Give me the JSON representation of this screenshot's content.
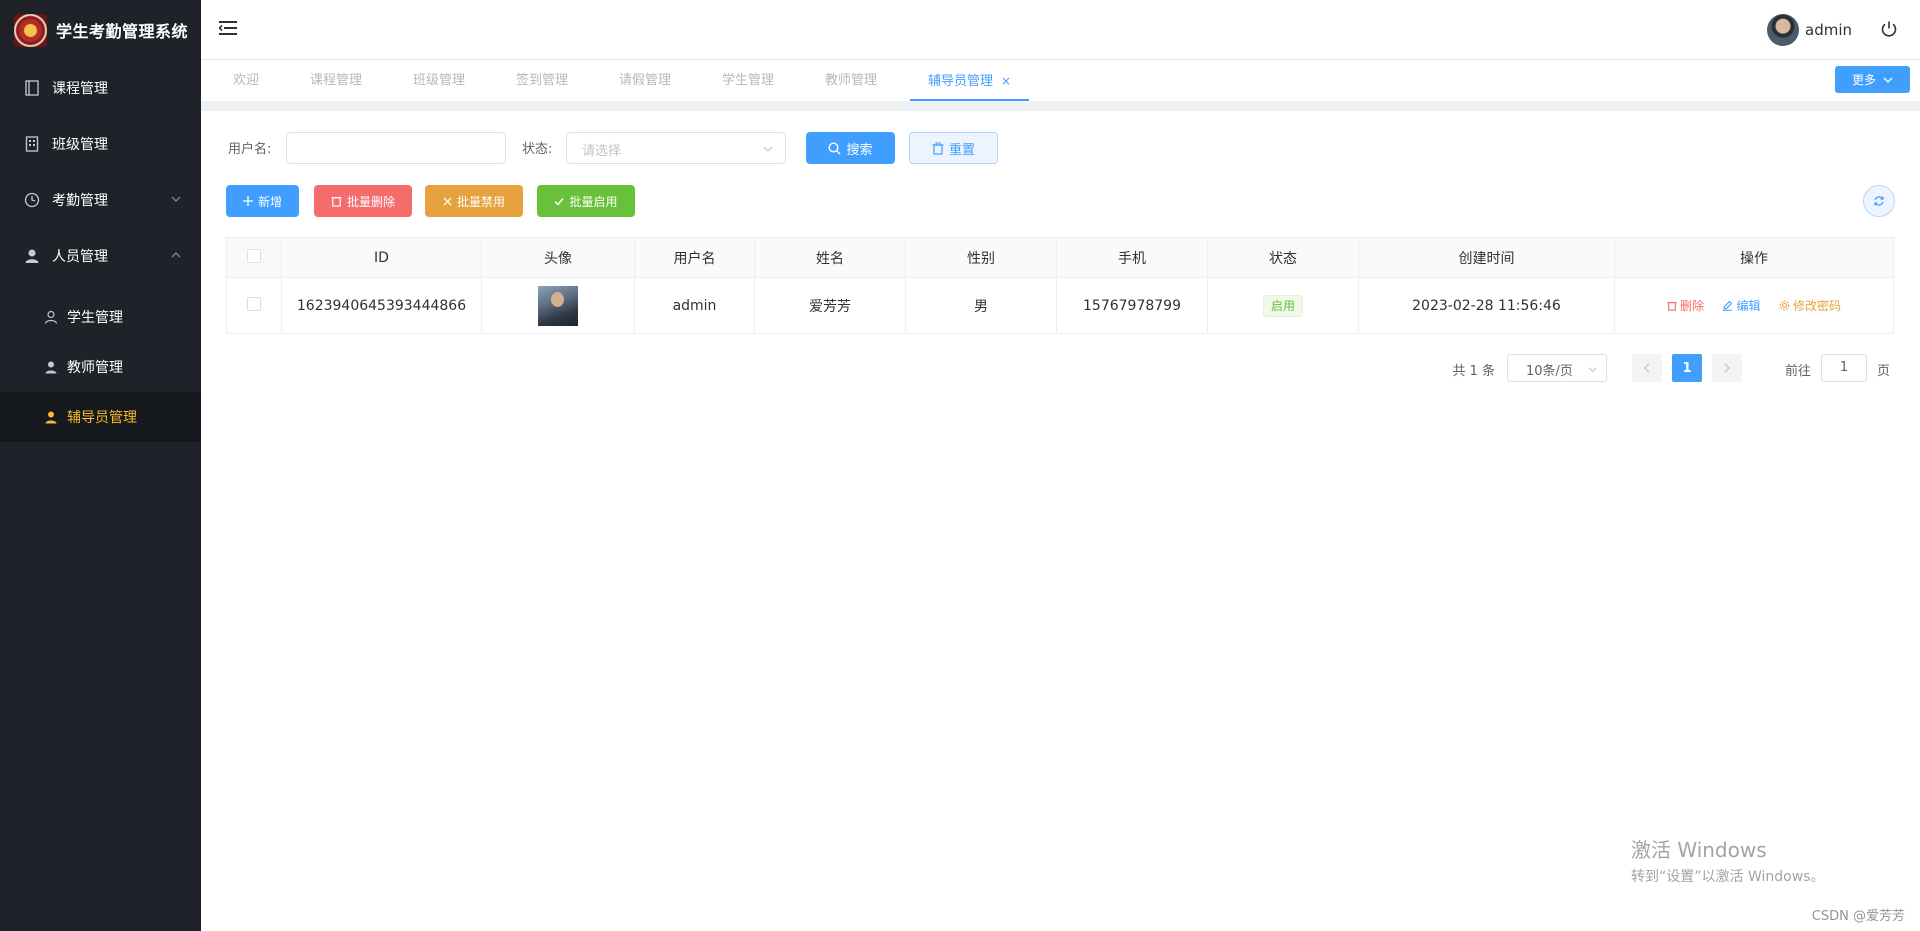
{
  "app": {
    "title": "学生考勤管理系统"
  },
  "sidebar": {
    "items": [
      {
        "label": "课程管理",
        "icon": "book-icon"
      },
      {
        "label": "班级管理",
        "icon": "building-icon"
      },
      {
        "label": "考勤管理",
        "icon": "clock-icon"
      },
      {
        "label": "人员管理",
        "icon": "user-icon"
      }
    ],
    "subitems": [
      {
        "label": "学生管理",
        "icon": "user-outline-icon"
      },
      {
        "label": "教师管理",
        "icon": "user-solid-icon"
      },
      {
        "label": "辅导员管理",
        "icon": "user-solid-icon",
        "active": true
      }
    ]
  },
  "header": {
    "user_name": "admin"
  },
  "tabs": [
    {
      "label": "欢迎"
    },
    {
      "label": "课程管理"
    },
    {
      "label": "班级管理"
    },
    {
      "label": "签到管理"
    },
    {
      "label": "请假管理"
    },
    {
      "label": "学生管理"
    },
    {
      "label": "教师管理"
    },
    {
      "label": "辅导员管理",
      "active": true,
      "close": "×"
    }
  ],
  "more_label": "更多",
  "filters": {
    "username_label": "用户名:",
    "username_value": "",
    "status_label": "状态:",
    "status_placeholder": "请选择",
    "search_label": "搜索",
    "reset_label": "重置"
  },
  "actions": {
    "add": "新增",
    "batch_delete": "批量删除",
    "batch_disable": "批量禁用",
    "batch_enable": "批量启用"
  },
  "table": {
    "columns": [
      "ID",
      "头像",
      "用户名",
      "姓名",
      "性别",
      "手机",
      "状态",
      "创建时间",
      "操作"
    ],
    "rows": [
      {
        "id": "1623940645393444866",
        "username": "admin",
        "name": "爱芳芳",
        "gender": "男",
        "phone": "15767978799",
        "status": "启用",
        "created": "2023-02-28 11:56:46",
        "ops": {
          "delete": "删除",
          "edit": "编辑",
          "change_password": "修改密码"
        }
      }
    ]
  },
  "pagination": {
    "total_text": "共 1 条",
    "page_size": "10条/页",
    "current_page": "1",
    "goto_label": "前往",
    "goto_value": "1",
    "page_unit": "页"
  },
  "watermark": {
    "line1": "激活 Windows",
    "line2": "转到“设置”以激活 Windows。"
  },
  "credit": "CSDN @爱芳芳",
  "colors": {
    "primary": "#409eff",
    "danger": "#f56c6c",
    "warning": "#e6a23c",
    "success": "#67c23a",
    "sidebar_bg": "#1f2329",
    "active_menu": "#f7ba2a"
  }
}
